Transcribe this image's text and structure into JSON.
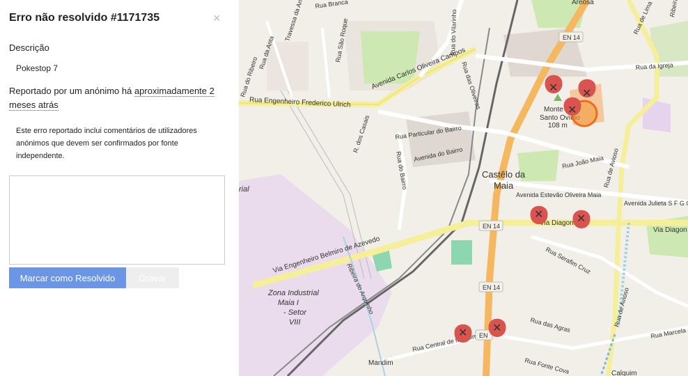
{
  "panel": {
    "title": "Erro não resolvido #1171735",
    "close_icon": "×",
    "description_label": "Descrição",
    "description_value": "Pokestop 7",
    "reported_prefix": "Reportado por um anónimo há ",
    "reported_time": "aproximadamente 2 meses atrás",
    "note": "Este erro reportado inclui comentários de utilizadores anónimos que devem ser confirmados por fonte independente.",
    "comment_value": "",
    "resolve_button": "Marcar como Resolvido",
    "save_button": "Gravar"
  },
  "map": {
    "labels": {
      "areosa": "Areosa",
      "en14_top": "EN 14",
      "rua_igreja": "Rua da Igreja",
      "av_carlos": "Avenida Carlos Oliveira Campos",
      "rua_frederico": "Rua Engenheiro Frederico Ulrich",
      "monte": "Monte",
      "santo_ovidio": "Santo Ovídio",
      "height": "108 m",
      "rua_particular": "Rua Particular do Bairro",
      "av_bairro": "Avenida do Bairro",
      "rua_joao_maia": "Rua João Maia",
      "castelo": "Castêlo da",
      "maia": "Maia",
      "av_estevao": "Avenida Estevão Oliveira Maia",
      "av_julieta": "Avenida Julieta S F G Guim",
      "en14_mid": "EN 14",
      "via_diagonal": "Via Diagonal",
      "via_diagon_right": "Via Diagon",
      "via_belmiro": "Via Engenheiro Belmiro de Azevedo",
      "rua_serafim": "Rua Serafim Cruz",
      "en14_low": "EN 14",
      "zona1": "Zona Industrial",
      "zona2": "Maia I",
      "zona3": "- Setor",
      "zona4": "VIII",
      "ribeira": "Ribeira do Arquinho",
      "rua_agras": "Rua das Agras",
      "rua_avioso": "Rua de Avioso",
      "rua_central": "Rua Central de Mandim",
      "en_low": "EN",
      "mandim": "Mandim",
      "rua_fonte": "Rua Fonte Cova",
      "calquim": "Calquim",
      "rua_marcela": "Rua Marcela",
      "rua_ribeiro": "Rua do Ribeiro",
      "rua_anta": "Rua da Anta",
      "travessa_anta": "Travessa da Anta",
      "rua_sao_roque": "Rua São Roque",
      "rua_vilarinho": "Rua do Vilarinho",
      "rua_oliveiras": "Rua das Oliveiras",
      "rua_casais": "R. dos Casais",
      "rua_do_bairro": "Rua do Bairro",
      "rua_avioso2": "Rua de Avioso",
      "rua_lima": "Rua de Lima",
      "ribeira_top": "Ribeira",
      "industrial": "rial",
      "rua_branca": "Rua Branca"
    }
  }
}
